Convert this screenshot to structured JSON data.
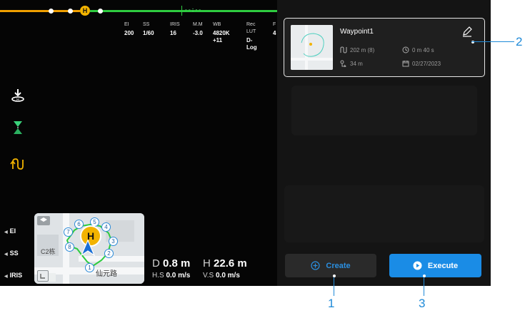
{
  "top_bar": {
    "timer": "--:--",
    "home_marker": "H"
  },
  "camera_params": [
    {
      "label": "EI",
      "value": "200"
    },
    {
      "label": "SS",
      "value": "1/60"
    },
    {
      "label": "IRIS",
      "value": "16"
    },
    {
      "label": "M.M",
      "value": "-3.0"
    },
    {
      "label": "WB",
      "value": "4820K +11"
    },
    {
      "label": "Rec LUT",
      "value": "D-Log"
    },
    {
      "label": "F",
      "value": "4"
    }
  ],
  "left_icons": [
    "landing-icon",
    "gimbal-direction-icon",
    "waypoint-route-icon"
  ],
  "side_controls": [
    "EI",
    "SS",
    "IRIS"
  ],
  "map": {
    "home_label": "H",
    "building_label": "C2栋",
    "road_label": "仙元路",
    "waypoints": [
      "1",
      "2",
      "3",
      "4",
      "5",
      "6",
      "7",
      "8"
    ]
  },
  "telemetry": {
    "d_label": "D",
    "d_value": "0.8 m",
    "h_label": "H",
    "h_value": "22.6 m",
    "hs_label": "H.S",
    "hs_value": "0.0 m/s",
    "vs_label": "V.S",
    "vs_value": "0.0 m/s"
  },
  "mission_card": {
    "title": "Waypoint1",
    "distance": "202 m (8)",
    "duration": "0 m 40 s",
    "altitude": "34 m",
    "date": "02/27/2023"
  },
  "buttons": {
    "create": "Create",
    "execute": "Execute"
  },
  "callouts": {
    "c1": "1",
    "c2": "2",
    "c3": "3"
  },
  "colors": {
    "accent_blue": "#1a8ce6",
    "callout_blue": "#1f8ad8",
    "track_green": "#2ecc40",
    "track_orange": "#f0a000"
  }
}
